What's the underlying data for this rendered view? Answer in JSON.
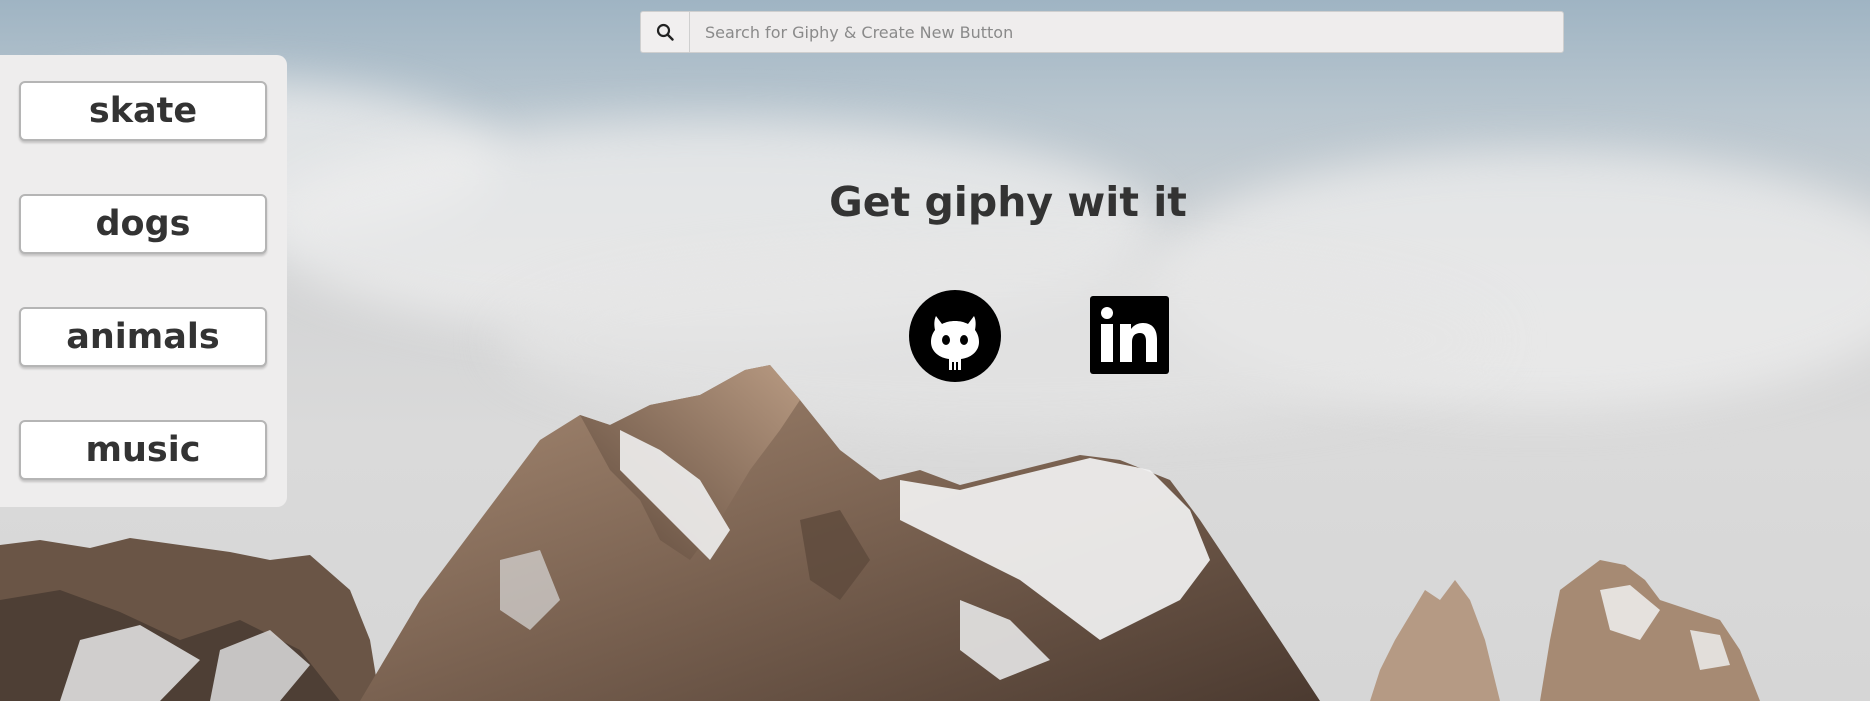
{
  "search": {
    "placeholder": "Search for Giphy & Create New Button",
    "value": "",
    "icon": "search-icon"
  },
  "sidebar": {
    "buttons": [
      {
        "label": "skate"
      },
      {
        "label": "dogs"
      },
      {
        "label": "animals"
      },
      {
        "label": "music"
      }
    ]
  },
  "main": {
    "title": "Get giphy wit it"
  },
  "social": [
    {
      "icon": "github-icon"
    },
    {
      "icon": "linkedin-icon"
    }
  ],
  "colors": {
    "sidebar_bg": "#eeeded",
    "button_bg": "#ffffff",
    "text": "#333333",
    "icon": "#000000"
  }
}
